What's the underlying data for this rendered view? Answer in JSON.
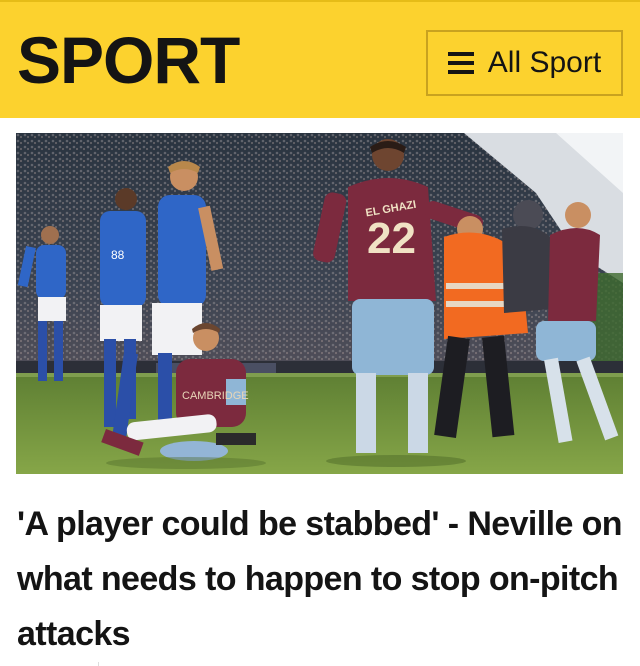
{
  "header": {
    "title": "SPORT",
    "menu_icon": "hamburger-menu-icon",
    "all_sport_label": "All Sport",
    "background_color": "#fcd22e"
  },
  "hero": {
    "shirt_number": "22",
    "shirt_name": "EL GHAZI"
  },
  "article": {
    "headline": "'A player could be stabbed' - Neville on what needs to happen to stop on-pitch attacks"
  }
}
